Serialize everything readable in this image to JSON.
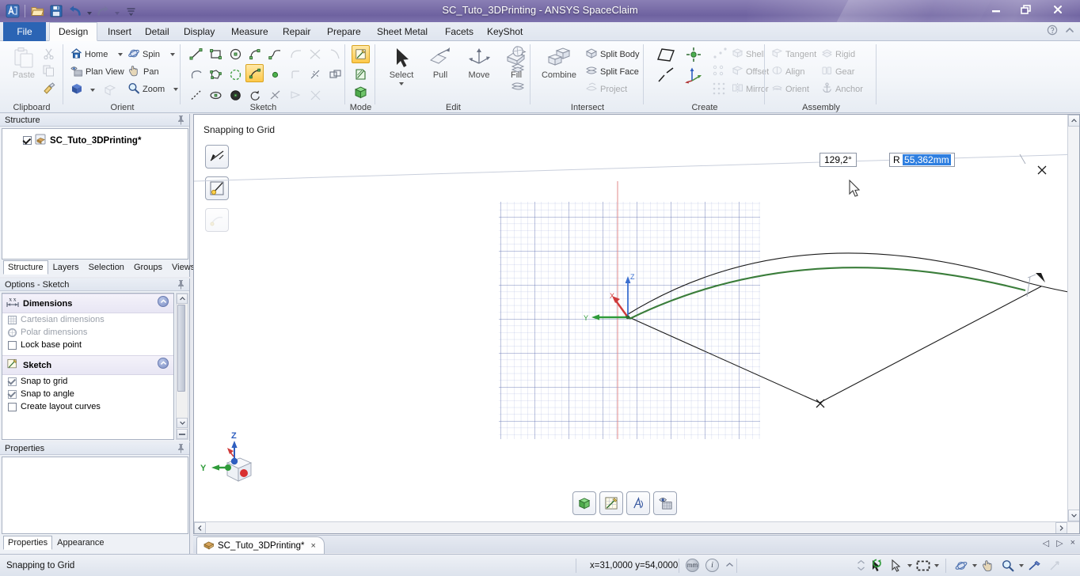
{
  "window": {
    "title": "SC_Tuto_3DPrinting - ANSYS SpaceClaim",
    "minimize_label": "Minimize",
    "maximize_label": "Restore",
    "close_label": "Close"
  },
  "quick_access": {
    "app_icon": "spaceclaim-app-icon",
    "items": [
      {
        "name": "open-icon",
        "label": "Open"
      },
      {
        "name": "save-icon",
        "label": "Save"
      },
      {
        "name": "undo-icon",
        "label": "Undo"
      },
      {
        "name": "redo-icon",
        "label": "Redo"
      },
      {
        "name": "customize-qat-icon",
        "label": "Customize Quick Access Toolbar"
      }
    ]
  },
  "menu": {
    "tabs": [
      {
        "label": "File",
        "state": "file"
      },
      {
        "label": "Design",
        "state": "active"
      },
      {
        "label": "Insert",
        "state": "normal"
      },
      {
        "label": "Detail",
        "state": "normal"
      },
      {
        "label": "Display",
        "state": "normal"
      },
      {
        "label": "Measure",
        "state": "normal"
      },
      {
        "label": "Repair",
        "state": "normal"
      },
      {
        "label": "Prepare",
        "state": "normal"
      },
      {
        "label": "Sheet Metal",
        "state": "normal"
      },
      {
        "label": "Facets",
        "state": "normal"
      },
      {
        "label": "KeyShot",
        "state": "normal"
      }
    ],
    "help_icons": [
      "help-icon",
      "collapse-ribbon-icon"
    ]
  },
  "ribbon": {
    "groups": [
      {
        "label": "Clipboard"
      },
      {
        "label": "Orient"
      },
      {
        "label": "Sketch"
      },
      {
        "label": "Mode"
      },
      {
        "label": "Edit"
      },
      {
        "label": "Intersect"
      },
      {
        "label": "Create"
      },
      {
        "label": "Assembly"
      }
    ],
    "clipboard": {
      "paste_label": "Paste",
      "cut_label": "Cut",
      "copy_label": "Copy",
      "format_painter_label": "Format Painter"
    },
    "orient": {
      "home_label": "Home",
      "plan_view_label": "Plan View",
      "view_cube_label": "View",
      "spin_label": "Spin",
      "pan_label": "Pan",
      "zoom_label": "Zoom"
    },
    "edit": {
      "select_label": "Select",
      "pull_label": "Pull",
      "move_label": "Move",
      "fill_label": "Fill"
    },
    "intersect": {
      "combine_label": "Combine",
      "split_body_label": "Split Body",
      "split_face_label": "Split Face",
      "project_label": "Project"
    },
    "create": {
      "shell_label": "Shell",
      "offset_label": "Offset",
      "mirror_label": "Mirror"
    },
    "assembly": {
      "tangent_label": "Tangent",
      "align_label": "Align",
      "orient_label": "Orient",
      "rigid_label": "Rigid",
      "gear_label": "Gear",
      "anchor_label": "Anchor"
    }
  },
  "structure_panel": {
    "title": "Structure",
    "tree": [
      {
        "label": "SC_Tuto_3DPrinting*",
        "checked": true
      }
    ],
    "tabs": [
      {
        "label": "Structure",
        "active": true
      },
      {
        "label": "Layers",
        "active": false
      },
      {
        "label": "Selection",
        "active": false
      },
      {
        "label": "Groups",
        "active": false
      },
      {
        "label": "Views",
        "active": false
      }
    ]
  },
  "options_panel": {
    "title": "Options - Sketch",
    "sections": [
      {
        "label": "Dimensions",
        "icon": "dimensions-icon",
        "items": [
          {
            "label": "Cartesian dimensions",
            "type": "radio",
            "checked": false,
            "disabled": true
          },
          {
            "label": "Polar dimensions",
            "type": "radio",
            "checked": false,
            "disabled": true
          },
          {
            "label": "Lock base point",
            "type": "checkbox",
            "checked": false,
            "disabled": false
          }
        ]
      },
      {
        "label": "Sketch",
        "icon": "sketch-icon",
        "items": [
          {
            "label": "Snap to grid",
            "type": "checkbox",
            "checked": true,
            "disabled": false
          },
          {
            "label": "Snap to angle",
            "type": "checkbox",
            "checked": true,
            "disabled": false
          },
          {
            "label": "Create layout curves",
            "type": "checkbox",
            "checked": false,
            "disabled": false
          }
        ]
      }
    ]
  },
  "properties_panel": {
    "title": "Properties",
    "tabs": [
      {
        "label": "Properties",
        "active": true
      },
      {
        "label": "Appearance",
        "active": false
      }
    ]
  },
  "viewport": {
    "hint": "Snapping to Grid",
    "mini_tools": [
      {
        "name": "sketch-line-tool",
        "enabled": true
      },
      {
        "name": "sketch-dimension-tool",
        "enabled": true
      },
      {
        "name": "sketch-extra-tool",
        "enabled": false
      }
    ],
    "dimensions": {
      "angle": "129,2°",
      "radius_prefix": "R",
      "radius_value": "55,362mm"
    },
    "bottom_tools": [
      {
        "name": "solid-mode-button",
        "label": "3D Mode"
      },
      {
        "name": "sketch-mode-button",
        "label": "Sketch Mode"
      },
      {
        "name": "section-mode-button",
        "label": "Section Mode"
      },
      {
        "name": "plan-view-button",
        "label": "Plan View"
      }
    ],
    "triad_axes": [
      "Z",
      "Y",
      "X"
    ]
  },
  "doc_tabs": {
    "tabs": [
      {
        "label": "SC_Tuto_3DPrinting*",
        "close": "×",
        "active": true
      }
    ],
    "nav": [
      "◁",
      "▷",
      "×"
    ]
  },
  "status_bar": {
    "message": "Snapping to Grid",
    "coordinates": "x=31,0000  y=54,0000",
    "indicators": [
      {
        "name": "units-indicator",
        "label": "mm"
      },
      {
        "name": "info-indicator",
        "label": "i"
      }
    ],
    "tools": [
      {
        "name": "spin-center-button",
        "label": "Spin Center"
      },
      {
        "name": "select-arrow-button",
        "label": "Select"
      },
      {
        "name": "box-select-button",
        "label": "Box Select"
      },
      {
        "name": "spin-button",
        "label": "Spin"
      },
      {
        "name": "pan-button",
        "label": "Pan"
      },
      {
        "name": "zoom-button",
        "label": "Zoom"
      },
      {
        "name": "sketch-pen-button",
        "label": "Sketch"
      },
      {
        "name": "pointer-button",
        "label": "Pointer"
      }
    ]
  },
  "colors": {
    "title_bar": "#7a6ea8",
    "file_tab": "#2b64b4",
    "selection_blue": "#2f7fe0",
    "sketch_green": "#3a7d3a",
    "grid_blue": "#7f8fc8",
    "accent_yellow": "#fdc84a"
  }
}
